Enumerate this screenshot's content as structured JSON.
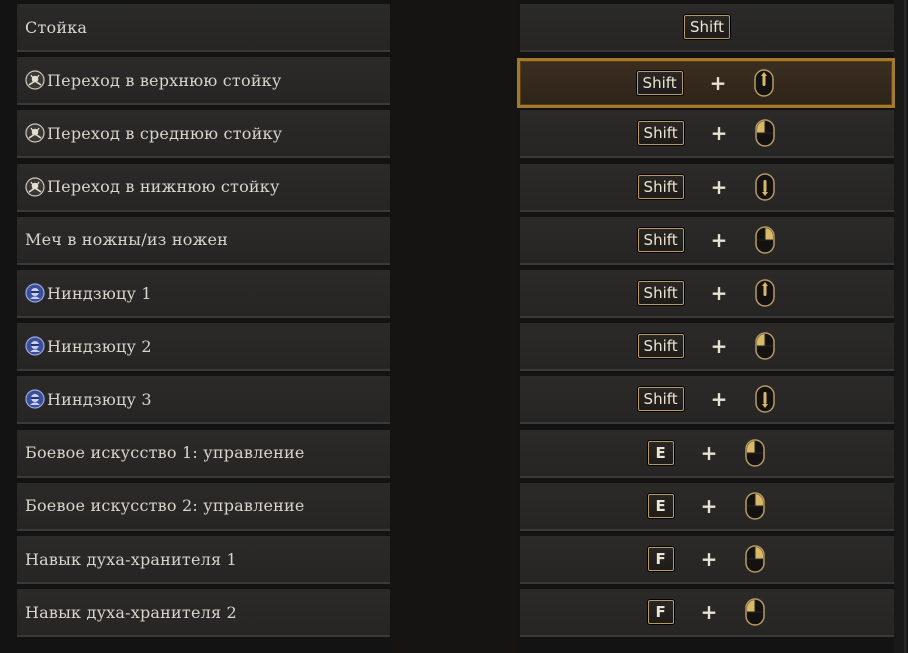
{
  "rows": [
    {
      "label": "Стойка",
      "icon": "",
      "keys": [
        "Shift"
      ],
      "mouse": ""
    },
    {
      "label": "Переход в верхнюю стойку",
      "icon": "stance-emblem-icon",
      "keys": [
        "Shift"
      ],
      "mouse": "wheel-up"
    },
    {
      "label": "Переход в среднюю стойку",
      "icon": "stance-emblem-icon",
      "keys": [
        "Shift"
      ],
      "mouse": "left-button"
    },
    {
      "label": "Переход в нижнюю стойку",
      "icon": "stance-emblem-icon",
      "keys": [
        "Shift"
      ],
      "mouse": "wheel-down"
    },
    {
      "label": "Меч в ножны/из ножен",
      "icon": "",
      "keys": [
        "Shift"
      ],
      "mouse": "right-button"
    },
    {
      "label": "Ниндзюцу 1",
      "icon": "ninja-emblem-icon",
      "keys": [
        "Shift"
      ],
      "mouse": "wheel-up"
    },
    {
      "label": "Ниндзюцу 2",
      "icon": "ninja-emblem-icon",
      "keys": [
        "Shift"
      ],
      "mouse": "left-button"
    },
    {
      "label": "Ниндзюцу 3",
      "icon": "ninja-emblem-icon",
      "keys": [
        "Shift"
      ],
      "mouse": "wheel-down"
    },
    {
      "label": "Боевое искусство 1: управление",
      "icon": "",
      "keys": [
        "E"
      ],
      "mouse": "left-button"
    },
    {
      "label": "Боевое искусство 2: управление",
      "icon": "",
      "keys": [
        "E"
      ],
      "mouse": "right-button"
    },
    {
      "label": "Навык духа-хранителя 1",
      "icon": "",
      "keys": [
        "F"
      ],
      "mouse": "right-button"
    },
    {
      "label": "Навык духа-хранителя 2",
      "icon": "",
      "keys": [
        "F"
      ],
      "mouse": "left-button"
    }
  ],
  "plus_sign": "+",
  "selected_row": 1,
  "colors": {
    "accent_gold": "#a37a2c",
    "key_border": "#b69a63",
    "text": "#d9d5cc"
  }
}
